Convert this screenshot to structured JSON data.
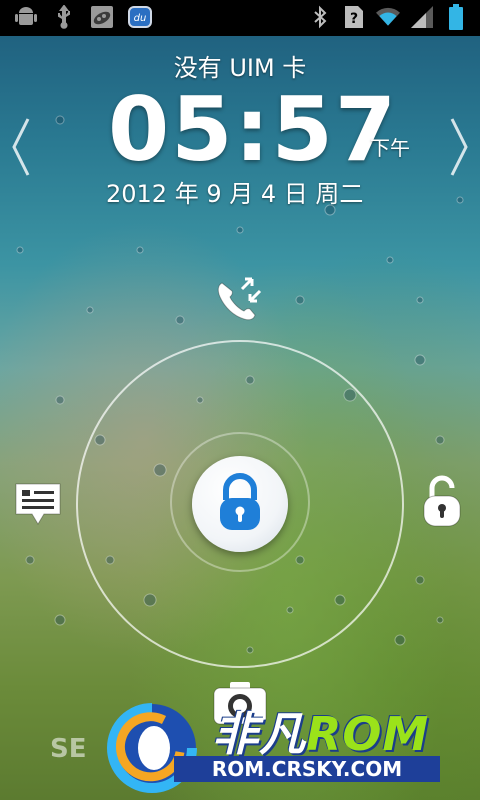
{
  "status_bar": {
    "notifications": [
      "android-icon",
      "usb-icon",
      "pea-app-icon",
      "du-app-icon"
    ],
    "indicators": [
      "bluetooth-icon",
      "sim-unknown-icon",
      "wifi-icon",
      "signal-icon",
      "battery-icon"
    ],
    "du_label": "du"
  },
  "lockscreen": {
    "carrier": "没有 UIM 卡",
    "time": "05:57",
    "ampm": "下午",
    "date": "2012 年 9 月 4 日 周二"
  },
  "unlock_targets": {
    "top": "phone-call-icon",
    "left": "message-icon",
    "right": "unlock-icon",
    "bottom": "camera-icon",
    "center": "lock-icon"
  },
  "watermark": {
    "brand_cn": "非凡",
    "brand_rom": "ROM",
    "site": "ROM.CRSKY.COM",
    "faint_text": "SE"
  },
  "colors": {
    "lock_blue": "#1f7fd8",
    "brand_green": "#9be21a",
    "brand_blue": "#1e3f99"
  }
}
